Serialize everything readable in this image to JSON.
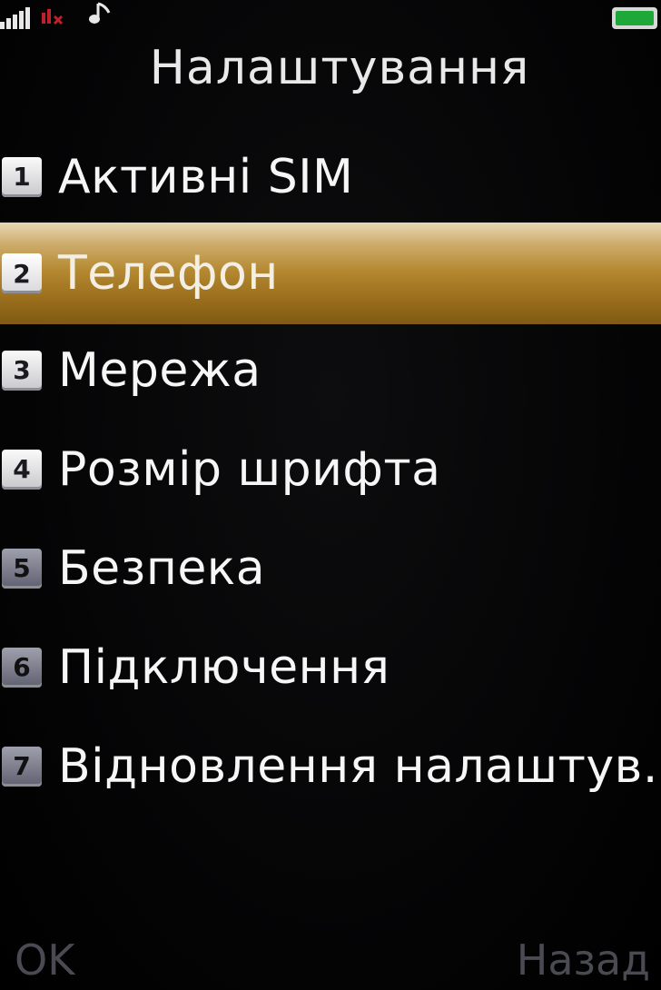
{
  "status": {
    "signal_icon": "signal-bars-icon",
    "sim2_icon": "no-sim-icon",
    "music_icon": "music-note-icon",
    "battery_icon": "battery-icon",
    "battery_color": "#1fa83a"
  },
  "title": "Налаштування",
  "menu": {
    "selected_index": 1,
    "items": [
      {
        "number": "1",
        "label": "Активні SIM"
      },
      {
        "number": "2",
        "label": "Телефон"
      },
      {
        "number": "3",
        "label": "Мережа"
      },
      {
        "number": "4",
        "label": "Розмір шрифта"
      },
      {
        "number": "5",
        "label": "Безпека"
      },
      {
        "number": "6",
        "label": "Підключення"
      },
      {
        "number": "7",
        "label": "Відновлення налаштув..."
      }
    ]
  },
  "softkeys": {
    "left": "OK",
    "right": "Назад"
  },
  "colors": {
    "highlight": "#b48830",
    "text": "#f6f6f6",
    "softkey": "#4a4a52"
  }
}
